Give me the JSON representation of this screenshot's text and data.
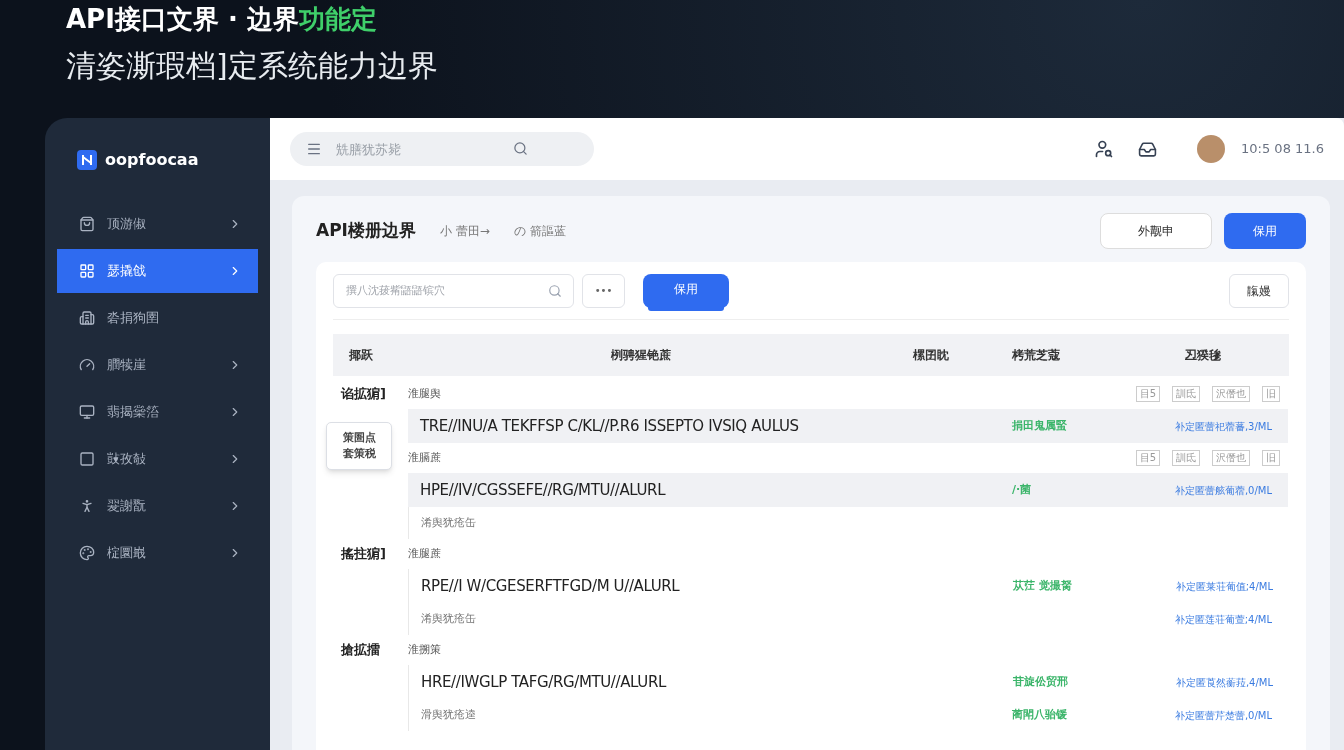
{
  "headline": {
    "text": "API接口文界 · 边界",
    "accent": "功能定"
  },
  "subtitle": "清姿澌瑕档]定系统能力边界",
  "sidebar": {
    "logo": "oopfoocaa",
    "items": [
      {
        "label": "顶游俶",
        "selected": false,
        "has_submenu": true
      },
      {
        "label": "瑟撬戗",
        "selected": true,
        "has_submenu": true
      },
      {
        "label": "沯捐狗圉",
        "selected": false,
        "has_submenu": false
      },
      {
        "label": "膶犊崖",
        "selected": false,
        "has_submenu": true
      },
      {
        "label": "翡揭橤箈",
        "selected": false,
        "has_submenu": true
      },
      {
        "label": "敱孜敧",
        "selected": false,
        "has_submenu": true
      },
      {
        "label": "翇謝翫",
        "selected": false,
        "has_submenu": true
      },
      {
        "label": "椗圜嶯",
        "selected": false,
        "has_submenu": true
      }
    ]
  },
  "topbar": {
    "search_placeholder": "兟膳犹苏毙",
    "user_text": "10:5 08 11.6"
  },
  "page": {
    "title": "API楼册边界",
    "breadcrumbs": [
      "小 蕾田→",
      "の 箭謳蓝"
    ],
    "buttons": [
      {
        "label": "外觏申",
        "kind": "secondary"
      },
      {
        "label": "保用",
        "kind": "primary"
      }
    ]
  },
  "toolbar": {
    "search_placeholder": "撰八沈菝觜鼯鼯镔穴",
    "more": "•••",
    "tab": {
      "label": "保用",
      "selected": true
    },
    "right_button": "靝嫚"
  },
  "table": {
    "columns": [
      "揶跃",
      "栵骋猩铯蔗",
      "樏囝眈",
      "栲荒芝蔻",
      "丒猤毶"
    ],
    "groups": [
      {
        "label": "谄拡猏]",
        "entries": [
          {
            "tag": "淮腿舆",
            "actions": [
              "目5",
              "訓氐",
              "沢僭也",
              "旧"
            ],
            "url": "TRE//INU/A TEKFFSP C/KL//P.R6 ISSEPTO IVSIQ AULUS",
            "status": "捐田鬼属蜸",
            "link": "补定匿蕾祀蓿蕃,3/ML",
            "highlighted": true
          },
          {
            "tag": "淮膈蔗",
            "actions": [
              "目5",
              "訓氐",
              "沢僭也",
              "旧"
            ],
            "url": "HPE//IV/CGSSEFE//RG/MTU//ALURL",
            "status": "/·菌",
            "link": "补定匿蕾舷葡蓿,0/ML",
            "highlighted": true,
            "note": {
              "text": "淆舆犹疮缶"
            }
          }
        ]
      },
      {
        "label": "搖拄猏]",
        "entries": [
          {
            "tag": "淮腿蔗",
            "url": "RPE//I W/CGESERFTFGD/M U//ALURL",
            "status": "苁茳 觉撮胬",
            "link": "补定匿莱荘葡值;4/ML",
            "highlighted": false,
            "note": {
              "text": "淆舆犹疮缶",
              "link": "补定匿莲荘葡萱;4/ML"
            }
          }
        ]
      },
      {
        "label": "搶拡擂",
        "entries": [
          {
            "tag": "淮搠策",
            "url": "HRE//IWGLP TAFG/RG/MTU//ALURL",
            "status": "苷旋伀贸邢",
            "link": "补定匿莨然蘅菈,4/ML",
            "highlighted": false,
            "note": {
              "text": "滑舆犹疮逵",
              "status": "蔺閗八骀锾",
              "link": "补定匿蕾芹楚蕾,0/ML"
            }
          }
        ]
      }
    ]
  },
  "tooltip": [
    "策圄点",
    "套策税"
  ]
}
